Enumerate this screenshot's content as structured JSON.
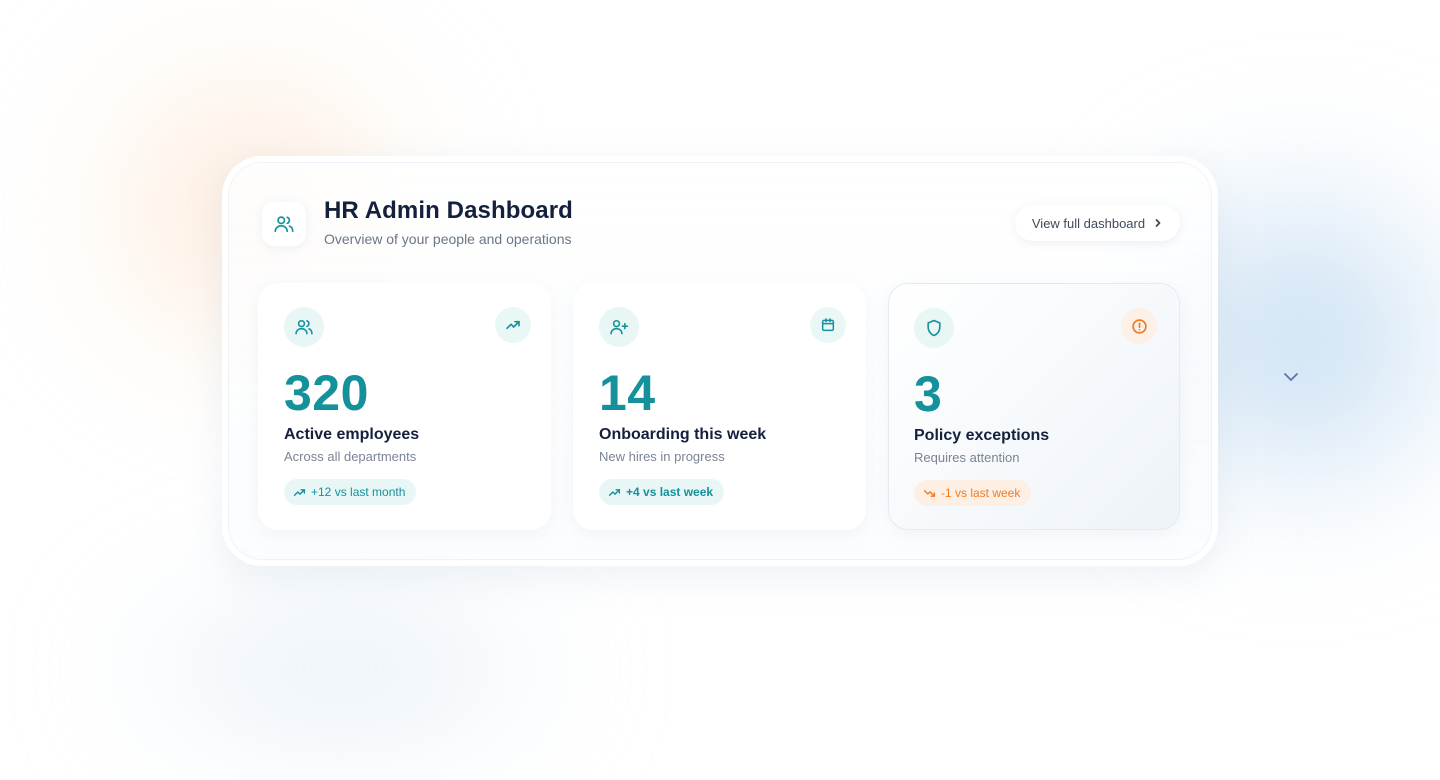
{
  "header": {
    "title": "HR Admin Dashboard",
    "subtitle": "Overview of your people and operations",
    "icon": "users-icon",
    "view_button_label": "View full dashboard",
    "view_button_icon": "chevron-right-icon"
  },
  "cards": [
    {
      "icon": "users-icon",
      "trend_icon": "trending-up-icon",
      "value": "320",
      "label": "Active employees",
      "sub": "Across all departments",
      "badge": "+12 vs last month",
      "badge_icon": "trending-up-icon"
    },
    {
      "icon": "user-plus-icon",
      "trend_icon": "calendar-icon",
      "value": "14",
      "label": "Onboarding this week",
      "sub": "New hires in progress",
      "badge": "+4 vs last week",
      "badge_icon": "trending-up-icon"
    },
    {
      "icon": "shield-icon",
      "trend_icon": "alert-circle-icon",
      "value": "3",
      "label": "Policy exceptions",
      "sub": "Requires attention",
      "badge": "-1 vs last week",
      "badge_icon": "trending-down-icon"
    }
  ],
  "scroll_indicator_icon": "chevron-down-icon",
  "colors": {
    "accent_teal": "#14919b",
    "warning_orange": "#f07b26",
    "title_text": "#14213d",
    "muted_text": "#7a8494",
    "teal_tint": "#e8f6f5",
    "orange_tint": "#fdefe4",
    "chevron_blue": "#5a76a8"
  }
}
